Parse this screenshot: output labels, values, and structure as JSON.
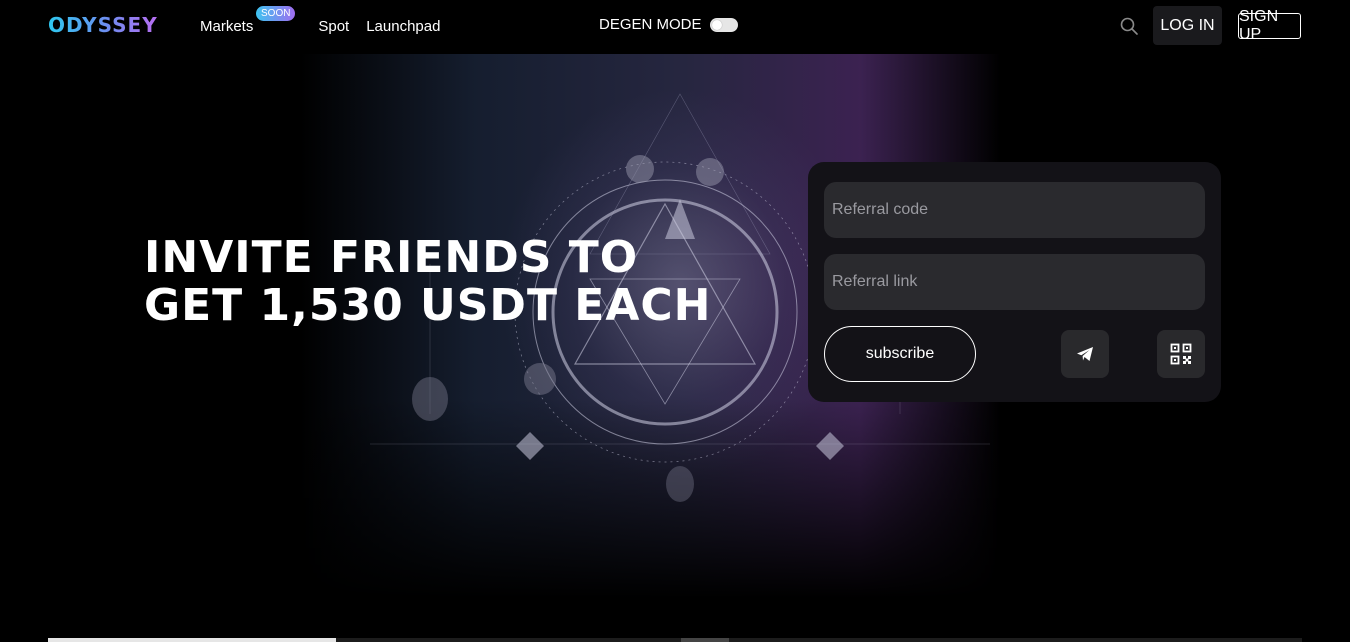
{
  "header": {
    "logo": "ODYSSEY",
    "nav": [
      {
        "label": "Markets",
        "badge": "SOON"
      },
      {
        "label": "Spot"
      },
      {
        "label": "Launchpad"
      }
    ],
    "degen_mode_label": "DEGEN MODE",
    "degen_mode_on": false,
    "login_label": "LOG IN",
    "signup_label": "SIGN UP",
    "icons": [
      "search-icon"
    ]
  },
  "hero": {
    "headline_line1": "INVITE FRIENDS TO",
    "headline_line2": "GET 1,530 USDT EACH"
  },
  "referral_card": {
    "code_placeholder": "Referral code",
    "link_placeholder": "Referral link",
    "subscribe_label": "subscribe",
    "icons": [
      "telegram-icon",
      "qr-code-icon"
    ]
  },
  "colors": {
    "brand_gradient_start": "#2ec8ef",
    "brand_gradient_end": "#b96df2",
    "card_bg": "#131217",
    "field_bg": "#2a2a2e"
  }
}
